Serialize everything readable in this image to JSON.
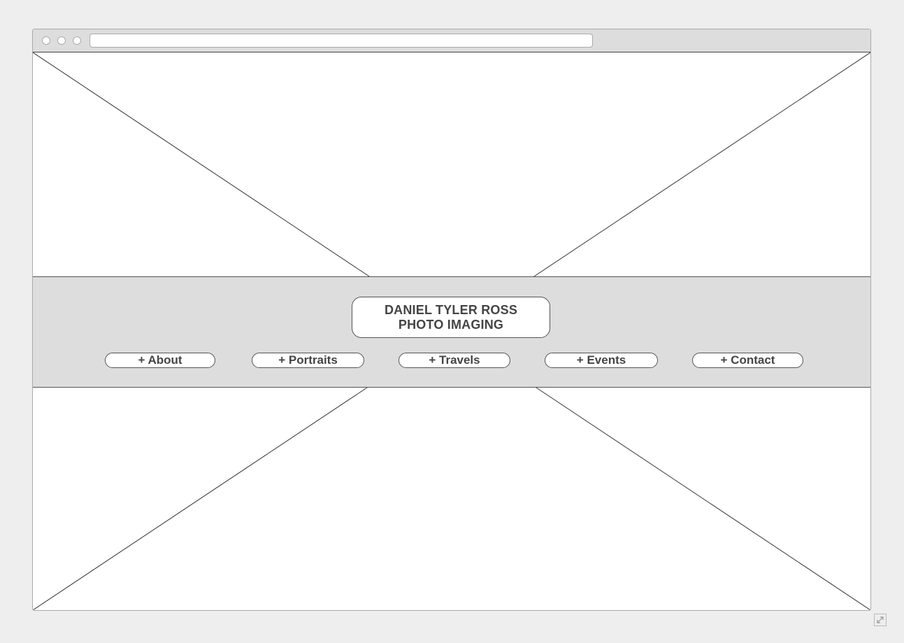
{
  "browser": {
    "address_bar_value": ""
  },
  "header": {
    "logo_line1": "DANIEL TYLER ROSS",
    "logo_line2": "PHOTO IMAGING"
  },
  "nav": {
    "items": [
      {
        "label": "+ About"
      },
      {
        "label": "+ Portraits"
      },
      {
        "label": "+ Travels"
      },
      {
        "label": "+ Events"
      },
      {
        "label": "+ Contact"
      }
    ]
  },
  "icons": {
    "image_placeholder": "image-placeholder-icon",
    "resize": "resize-icon"
  },
  "colors": {
    "page_background": "#eeeeee",
    "chrome_gray": "#dddddd",
    "text": "#444444",
    "border": "#555555"
  }
}
